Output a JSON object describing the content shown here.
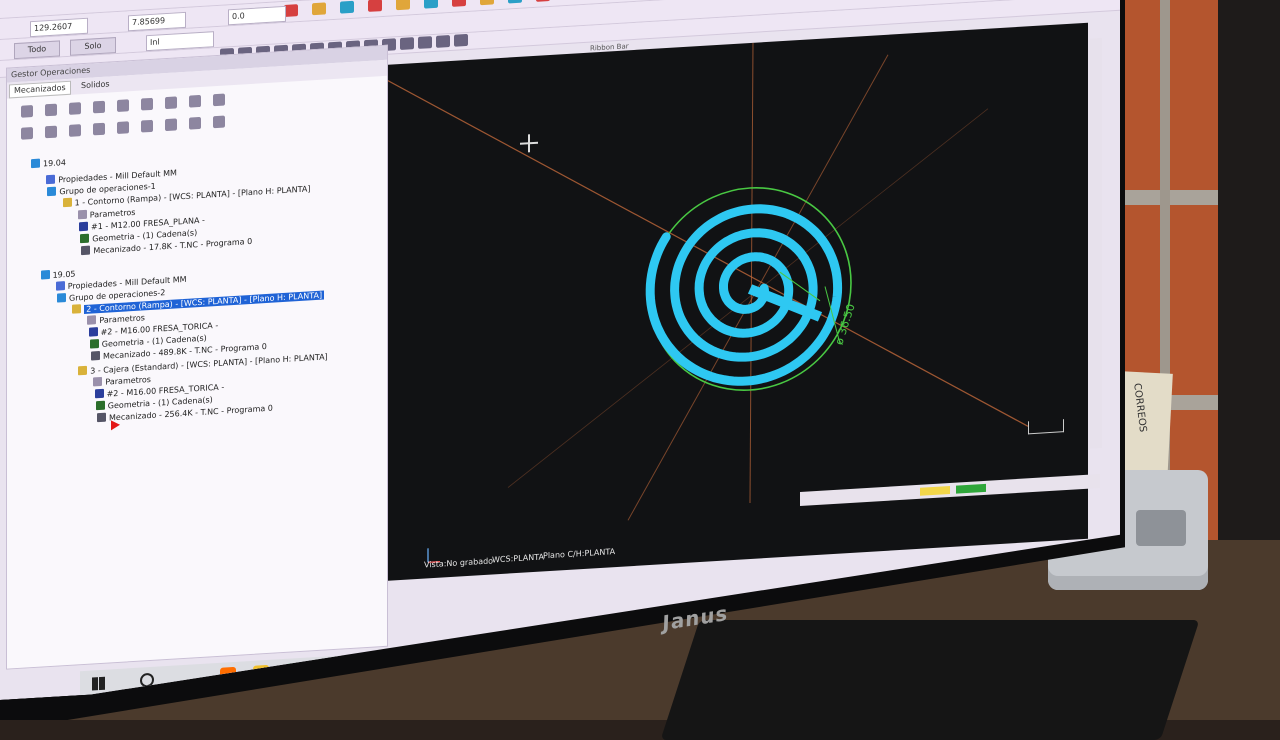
{
  "monitor": {
    "brand": "Janus"
  },
  "environment": {
    "card_text": "CORREOS"
  },
  "toolbar": {
    "coord_x": "129.2607",
    "coord_y": "7.85699",
    "coord_z": "0.0",
    "todo_label": "Todo",
    "solo_label": "Solo",
    "mode_value": "Inl"
  },
  "ribbon_label": "Ribbon Bar",
  "panel": {
    "title": "Gestor Operaciones",
    "tabs": [
      "Mecanizados",
      "Solidos"
    ]
  },
  "tree": [
    {
      "label": "19.04",
      "indent": 0,
      "icon": "#2a8ad8"
    },
    {
      "label": "Propiedades - Mill Default MM",
      "indent": 1,
      "icon": "#4a6bd6"
    },
    {
      "label": "Grupo de operaciones-1",
      "indent": 1,
      "icon": "#2a8ad8"
    },
    {
      "label": "1 - Contorno  (Rampa) - [WCS: PLANTA] - [Plano H: PLANTA]",
      "indent": 2,
      "icon": "#d9b23a"
    },
    {
      "label": "Parametros",
      "indent": 3,
      "icon": "#9a90ab"
    },
    {
      "label": "#1 - M12.00 FRESA_PLANA -",
      "indent": 3,
      "icon": "#2b3e9c"
    },
    {
      "label": "Geometria - (1) Cadena(s)",
      "indent": 3,
      "icon": "#2b6e2b"
    },
    {
      "label": "Mecanizado - 17.8K - T.NC - Programa 0",
      "indent": 3,
      "icon": "#556"
    },
    {
      "label": "19.05",
      "indent": 0,
      "icon": "#2a8ad8"
    },
    {
      "label": "Propiedades - Mill Default MM",
      "indent": 1,
      "icon": "#4a6bd6"
    },
    {
      "label": "Grupo de operaciones-2",
      "indent": 1,
      "icon": "#2a8ad8"
    },
    {
      "label": "2 - Contorno  (Rampa) - [WCS: PLANTA] - [Plano H: PLANTA]",
      "indent": 2,
      "icon": "#d9b23a",
      "selected": true
    },
    {
      "label": "Parametros",
      "indent": 3,
      "icon": "#9a90ab"
    },
    {
      "label": "#2 - M16.00 FRESA_TORICA -",
      "indent": 3,
      "icon": "#2b3e9c"
    },
    {
      "label": "Geometria - (1) Cadena(s)",
      "indent": 3,
      "icon": "#2b6e2b"
    },
    {
      "label": "Mecanizado - 489.8K - T.NC - Programa 0",
      "indent": 3,
      "icon": "#556"
    },
    {
      "label": "3 - Cajera (Estandard) - [WCS: PLANTA] - [Plano H: PLANTA]",
      "indent": 2,
      "icon": "#d9b23a"
    },
    {
      "label": "Parametros",
      "indent": 3,
      "icon": "#9a90ab"
    },
    {
      "label": "#2 - M16.00 FRESA_TORICA -",
      "indent": 3,
      "icon": "#2b3e9c"
    },
    {
      "label": "Geometria - (1) Cadena(s)",
      "indent": 3,
      "icon": "#2b6e2b"
    },
    {
      "label": "Mecanizado - 256.4K - T.NC - Programa 0",
      "indent": 3,
      "icon": "#556"
    }
  ],
  "viewport": {
    "dimension_label": "ø 36.50",
    "status_left": "Vista:No grabado",
    "status_wcs": "WCS:PLANTA",
    "status_plane": "Plano C/H:PLANTA",
    "colors": {
      "toolpath": "#2ec8f2",
      "boundary": "#49c843",
      "axes": "#c0683a"
    }
  },
  "taskbar": {
    "apps": [
      {
        "name": "chrome-icon-orange",
        "color": "#ff6d00"
      },
      {
        "name": "file-explorer-icon",
        "color": "#f0c02c"
      },
      {
        "name": "whatsapp-icon",
        "color": "#25d366"
      },
      {
        "name": "ec-app-icon",
        "color": "#1fa34a"
      },
      {
        "name": "sheets-icon",
        "color": "#21a366"
      },
      {
        "name": "ec-app-icon-2",
        "color": "#596068"
      },
      {
        "name": "firefox-icon",
        "color": "#ff6a00"
      },
      {
        "name": "tiles-icon",
        "color": "#d3333a"
      },
      {
        "name": "calendar-icon",
        "color": "#3a7bd5"
      },
      {
        "name": "chrome-icon",
        "color": "#db4437"
      },
      {
        "name": "mastercam-2020-icon",
        "color": "#c9232e"
      },
      {
        "name": "onedrive-icon",
        "color": "#2a6fd6"
      },
      {
        "name": "mastercam-icon",
        "color": "#b32a2a"
      },
      {
        "name": "sheets-icon-2",
        "color": "#21a366"
      },
      {
        "name": "mastercam-icon-2",
        "color": "#d01818"
      }
    ]
  }
}
